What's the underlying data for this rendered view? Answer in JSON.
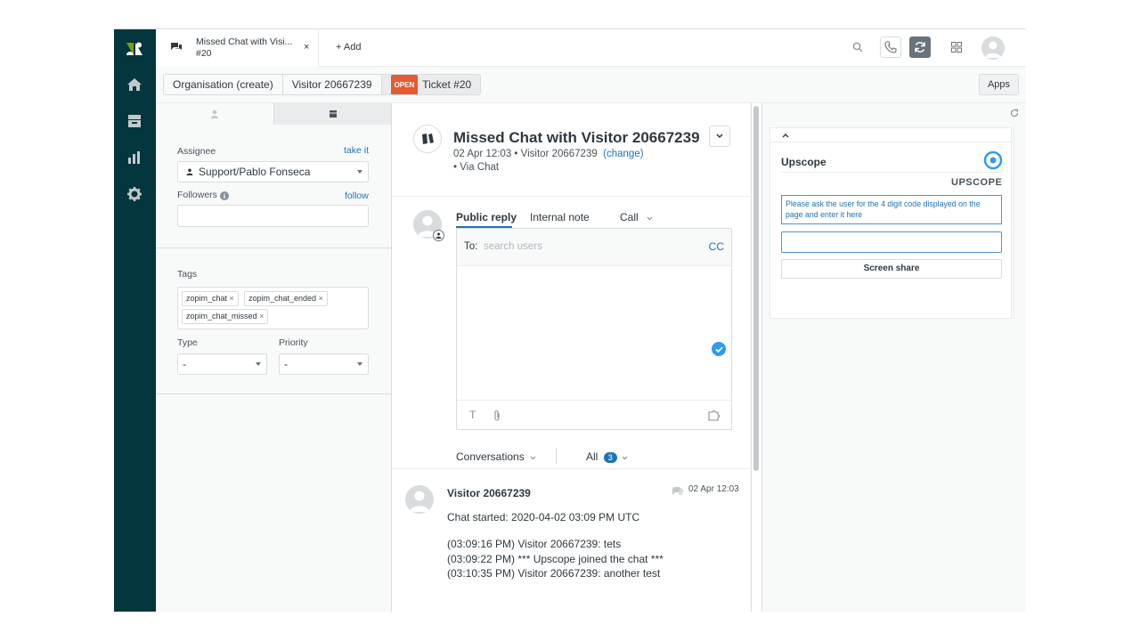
{
  "tab": {
    "title_line1": "Missed Chat with Visi...",
    "title_line2": "#20",
    "close": "×"
  },
  "add_tab": "+ Add",
  "breadcrumbs": {
    "org": "Organisation (create)",
    "visitor": "Visitor 20667239",
    "status": "OPEN",
    "ticket": "Ticket #20"
  },
  "apps_button": "Apps",
  "properties": {
    "assignee_label": "Assignee",
    "take_it": "take it",
    "assignee_value": "Support/Pablo Fonseca",
    "followers_label": "Followers",
    "follow": "follow",
    "tags_label": "Tags",
    "tags": [
      "zopim_chat",
      "zopim_chat_ended",
      "zopim_chat_missed"
    ],
    "type_label": "Type",
    "type_value": "-",
    "priority_label": "Priority",
    "priority_value": "-"
  },
  "ticket": {
    "title": "Missed Chat with Visitor 20667239",
    "meta": "02 Apr 12:03 • Visitor 20667239",
    "change": "(change)",
    "via": "• Via Chat"
  },
  "reply": {
    "tabs": [
      "Public reply",
      "Internal note",
      "Call"
    ],
    "to_label": "To:",
    "to_placeholder": "search users",
    "cc": "CC"
  },
  "filters": {
    "conversations": "Conversations",
    "all": "All",
    "count": "3"
  },
  "message": {
    "author": "Visitor 20667239",
    "time": "02 Apr 12:03",
    "started": "Chat started: 2020-04-02 03:09 PM UTC",
    "lines": [
      "(03:09:16 PM) Visitor 20667239: tets",
      "(03:09:22 PM) *** Upscope joined the chat ***",
      "(03:10:35 PM) Visitor 20667239: another test"
    ]
  },
  "upscope": {
    "title": "Upscope",
    "brand": "UPSCOPE",
    "instructions": "Please ask the user for the 4 digit code displayed on the page and enter it here",
    "input_value": "",
    "button": "Screen share"
  },
  "colors": {
    "nav": "#03363d",
    "accent": "#1f73b7",
    "open": "#e35b33",
    "logo_green": "#78a300"
  }
}
